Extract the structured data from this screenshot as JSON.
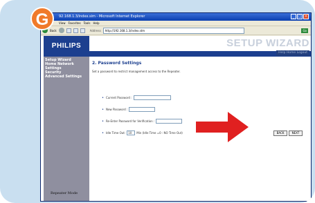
{
  "badge": "G",
  "browser": {
    "title": "92.168.1.3/index.sim - Microsoft Internet Explorer",
    "menu": [
      "View",
      "Favorites",
      "Tools",
      "Help"
    ],
    "back_label": "Back",
    "address_label": "Address",
    "address_value": "http://192.168.1.3/index.stm",
    "go_label": "Go"
  },
  "header": {
    "brand": "PHILIPS",
    "wizard_title": "SETUP WIZARD",
    "top_links": "Help  Home  Logout"
  },
  "sidebar": {
    "items": [
      "Setup Wizard",
      "Home Network Settings",
      "Security",
      "Advanced Settings"
    ],
    "mode": "Repeater Mode"
  },
  "panel": {
    "title": "2. Password Settings",
    "description": "Set a password to restrict management access to the Repeater.",
    "current_password_label": "Current Password :",
    "new_password_label": "New Password :",
    "reenter_label": "Re-Enter Password for Verification :",
    "idle_label": "Idle Time Out:",
    "idle_value": "10",
    "idle_suffix": "Min (Idle Time =0 : NO Time Out)"
  },
  "buttons": {
    "back": "BACK",
    "next": "NEXT"
  },
  "colors": {
    "arrow": "#e02020",
    "brand_blue": "#1c3f8f",
    "sidebar": "#8f8f9f"
  }
}
